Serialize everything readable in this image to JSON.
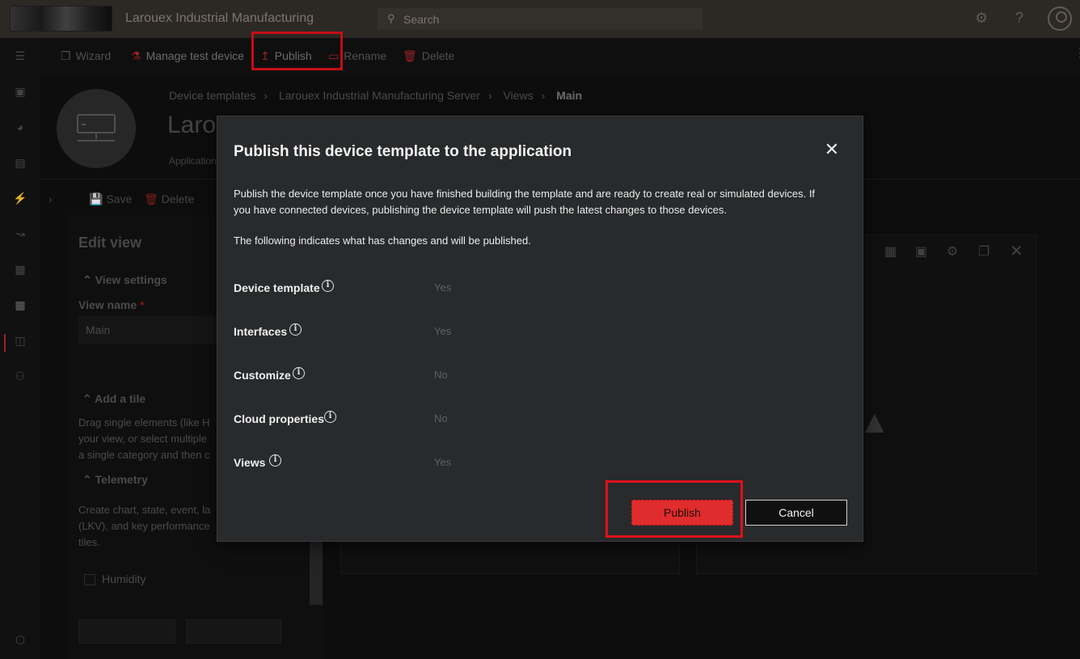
{
  "header": {
    "app_title": "Larouex Industrial Manufacturing",
    "search_placeholder": "Search"
  },
  "commandbar": {
    "items": [
      {
        "label": "Wizard",
        "icon": "copy-icon"
      },
      {
        "label": "Manage test device",
        "icon": "flask-icon"
      },
      {
        "label": "Publish",
        "icon": "upload-arrow-icon"
      },
      {
        "label": "Rename",
        "icon": "rename-icon"
      },
      {
        "label": "Delete",
        "icon": "trash-icon"
      }
    ]
  },
  "breadcrumb": {
    "items": [
      "Device templates",
      "Larouex Industrial Manufacturing Server",
      "Views"
    ],
    "current": "Main"
  },
  "template_header": {
    "title": "Laro",
    "subtitle": "Application"
  },
  "subcommand": {
    "save": "Save",
    "delete": "Delete"
  },
  "edit_panel": {
    "title": "Edit view",
    "view_settings": "View settings",
    "view_name_label": "View name",
    "view_name_value": "Main",
    "add_tile": "Add a tile",
    "add_tile_desc_1": "Drag single elements (like H",
    "add_tile_desc_2": "your view, or select multiple",
    "add_tile_desc_3": "a single category and then c",
    "telemetry": "Telemetry",
    "telemetry_desc_1": "Create chart, state, event, la",
    "telemetry_desc_2": "(LKV), and key performance",
    "telemetry_desc_3": "tiles.",
    "humidity": "Humidity"
  },
  "dialog": {
    "title": "Publish this device template to the application",
    "description": "Publish the device template once you have finished building the template and are ready to create real or simulated devices. If you have connected devices, publishing the device template will push the latest changes to those devices.",
    "changes_intro": "The following indicates what has changes and will be published.",
    "rows": [
      {
        "label": "Device template",
        "value": "Yes"
      },
      {
        "label": "Interfaces",
        "value": "Yes"
      },
      {
        "label": "Customize",
        "value": "No"
      },
      {
        "label": "Cloud properties",
        "value": "No"
      },
      {
        "label": "Views",
        "value": "Yes"
      }
    ],
    "publish_button": "Publish",
    "cancel_button": "Cancel"
  },
  "colors": {
    "accent_red": "#e02c2c",
    "highlight_red": "#e0111a",
    "dialog_bg": "#282a2c",
    "topbar_bg": "#332e28"
  }
}
